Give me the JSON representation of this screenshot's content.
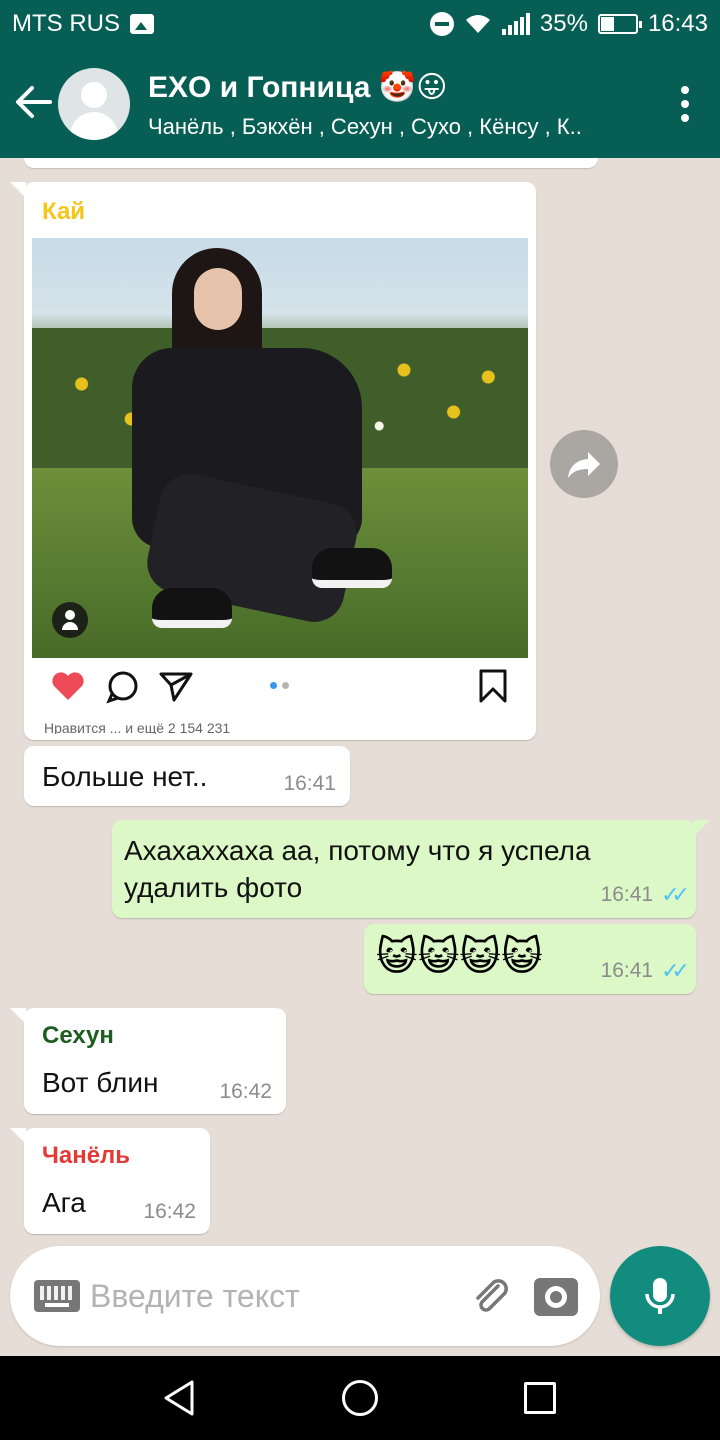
{
  "status_bar": {
    "carrier": "MTS RUS",
    "battery": "35%",
    "battery_level": 0.35,
    "time": "16:43"
  },
  "header": {
    "title": "EXO и Гопница 🤡😛",
    "subtitle": "Чанёль , Бэкхён , Сехун , Сухо , Кёнсу , К.."
  },
  "colors": {
    "header_bg": "#075e54",
    "incoming_bubble": "#ffffff",
    "outgoing_bubble": "#dcf8c6",
    "chat_bg": "#e6ded6",
    "mic_button": "#128c7e",
    "read_ticks": "#4fc3f7",
    "sender_kai": "#f5c518",
    "sender_sehun": "#1b5e20",
    "sender_chanyeol": "#e53935"
  },
  "messages": [
    {
      "id": "kai-post",
      "direction": "in",
      "sender": "Кай",
      "type": "image",
      "caption_strip": "Нравится ... и ещё 2 154 231"
    },
    {
      "id": "m1",
      "direction": "in",
      "text": "Больше нет..",
      "time": "16:41"
    },
    {
      "id": "m2",
      "direction": "out",
      "text": "Ахахаххаха аа, потому что я успела удалить фото",
      "time": "16:41",
      "status": "read"
    },
    {
      "id": "m3",
      "direction": "out",
      "text": "😺😺😺😺",
      "time": "16:41",
      "status": "read"
    },
    {
      "id": "m4",
      "direction": "in",
      "sender": "Сехун",
      "text": "Вот блин",
      "time": "16:42"
    },
    {
      "id": "m5",
      "direction": "in",
      "sender": "Чанёль",
      "text": "Ага",
      "time": "16:42"
    }
  ],
  "input": {
    "placeholder": "Введите текст"
  },
  "icons": {
    "back": "arrow-left-icon",
    "menu": "more-vert-icon",
    "forward": "share-forward-icon",
    "keyboard": "keyboard-icon",
    "attach": "paperclip-icon",
    "camera": "camera-icon",
    "mic": "microphone-icon",
    "post_like": "heart-icon",
    "post_comment": "comment-icon",
    "post_share": "paper-plane-icon",
    "post_save": "bookmark-icon"
  }
}
